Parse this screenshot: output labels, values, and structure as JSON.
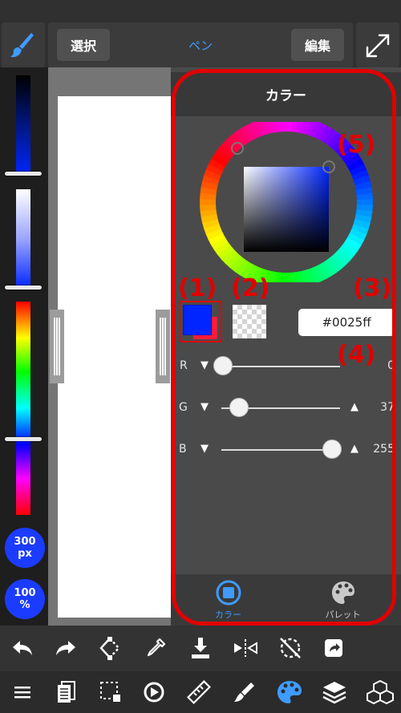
{
  "toolbar": {
    "select_label": "選択",
    "tool_name": "ペン",
    "edit_label": "編集"
  },
  "left_rail": {
    "brush_size_value": "300",
    "brush_size_unit": "px",
    "opacity_value": "100",
    "opacity_unit": "%"
  },
  "color_panel": {
    "title": "カラー",
    "hex_value": "#0025ff",
    "main_color": "#0025ff",
    "secondary_color": "#ff1a3a",
    "sliders": [
      {
        "label": "R",
        "value": "0",
        "fraction": 0.0
      },
      {
        "label": "G",
        "value": "37",
        "fraction": 0.145
      },
      {
        "label": "B",
        "value": "255",
        "fraction": 1.0
      }
    ],
    "tabs": [
      {
        "label": "カラー",
        "active": true,
        "color": "#3f9bff"
      },
      {
        "label": "パレット",
        "active": false,
        "color": "#c8c8c8"
      }
    ]
  },
  "annotations": {
    "n1": "(1)",
    "n2": "(2)",
    "n3": "(3)",
    "n4": "(4)",
    "n5": "(5)",
    "color": "#e10000"
  },
  "accent_color": "#3f9bff",
  "bottom_toolbar_1": [
    "undo-icon",
    "redo-icon",
    "transform-icon",
    "eyedropper-icon",
    "save-icon",
    "flip-icon",
    "snap-off-icon",
    "share-icon"
  ],
  "bottom_toolbar_2": [
    "menu-icon",
    "layers-list-icon",
    "selection-icon",
    "fill-icon",
    "ruler-icon",
    "brush-tool-icon",
    "palette-icon",
    "layers-icon",
    "material-icon"
  ]
}
